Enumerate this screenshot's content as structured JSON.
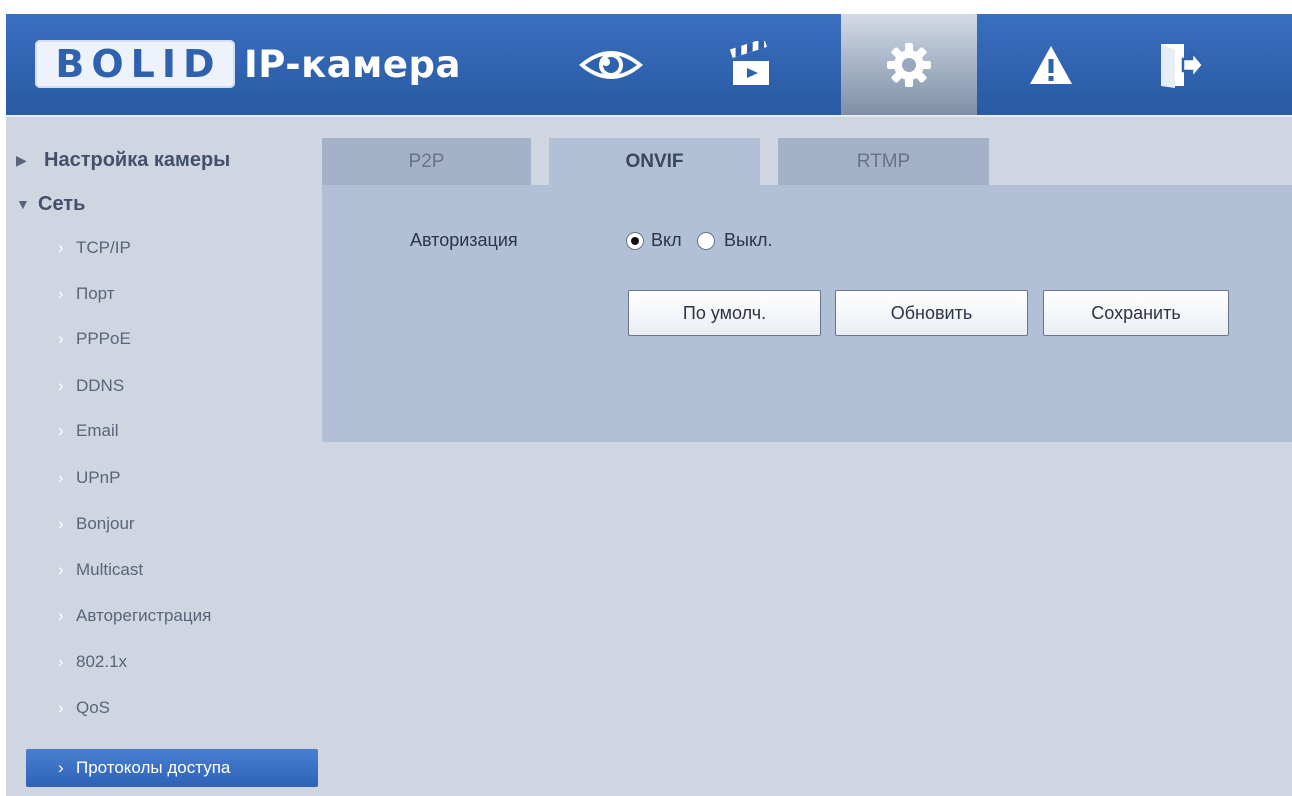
{
  "header": {
    "logo_text": "BOLID",
    "title": "IP-камера",
    "nav_icons": [
      "eye-icon",
      "clapperboard-icon",
      "gear-icon",
      "warning-icon",
      "exit-icon"
    ],
    "active_icon": "gear-icon",
    "colors": {
      "bar": "#2f62ae",
      "active": "#8f9db2"
    }
  },
  "sidebar": {
    "sections": [
      {
        "label": "Настройка камеры",
        "state": "collapsed"
      },
      {
        "label": "Сеть",
        "state": "expanded"
      }
    ],
    "items": [
      {
        "label": "TCP/IP"
      },
      {
        "label": "Порт"
      },
      {
        "label": "PPPoE"
      },
      {
        "label": "DDNS"
      },
      {
        "label": "Email"
      },
      {
        "label": "UPnP"
      },
      {
        "label": "Bonjour"
      },
      {
        "label": "Multicast"
      },
      {
        "label": "Авторегистрация"
      },
      {
        "label": "802.1x"
      },
      {
        "label": "QoS"
      },
      {
        "label": "Протоколы доступа",
        "selected": true
      }
    ]
  },
  "tabs": [
    {
      "label": "P2P"
    },
    {
      "label": "ONVIF",
      "active": true
    },
    {
      "label": "RTMP"
    }
  ],
  "form": {
    "auth_label": "Авторизация",
    "auth_options": [
      "Вкл",
      "Выкл."
    ],
    "auth_selected": "Вкл",
    "buttons": {
      "default_label": "По умолч.",
      "refresh_label": "Обновить",
      "save_label": "Сохранить"
    }
  }
}
